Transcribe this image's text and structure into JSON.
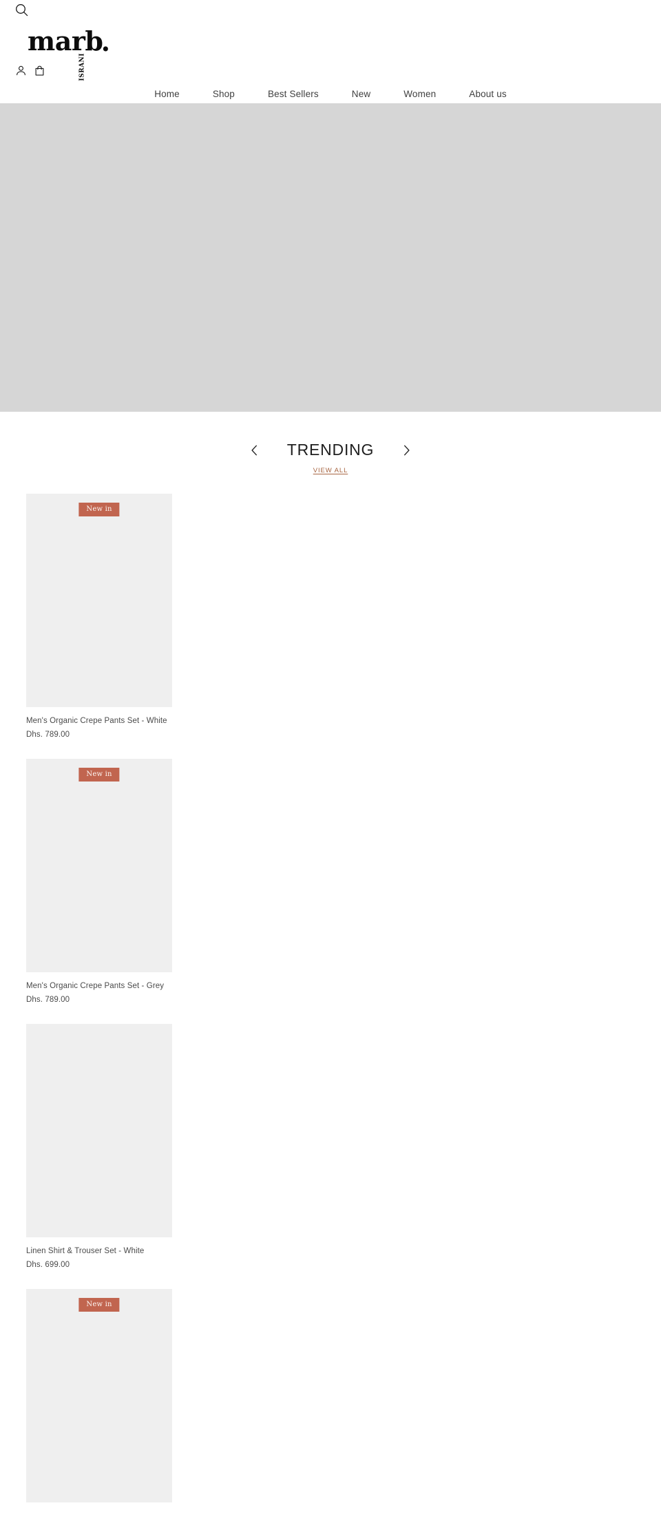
{
  "header": {
    "search_icon": "search-icon",
    "account_icon": "user-account-icon",
    "bag_icon": "shopping-bag-icon",
    "logo": {
      "wordmark": "marb",
      "vertical_text": "ISRANI",
      "dot": "."
    },
    "nav": [
      {
        "label": "Home"
      },
      {
        "label": "Shop"
      },
      {
        "label": "Best Sellers"
      },
      {
        "label": "New"
      },
      {
        "label": "Women"
      },
      {
        "label": "About us"
      }
    ]
  },
  "hero": {
    "background_color": "#d6d6d6"
  },
  "trending": {
    "title": "TRENDING",
    "prev_icon": "chevron-left-icon",
    "next_icon": "chevron-right-icon",
    "view_all_label": "VIEW ALL",
    "view_all_color": "#a6633f"
  },
  "products": [
    {
      "badge": "New in",
      "title": "Men's Organic Crepe Pants Set - White",
      "price": "Dhs. 789.00"
    },
    {
      "badge": "New in",
      "title": "Men's Organic Crepe Pants Set - Grey",
      "price": "Dhs. 789.00"
    },
    {
      "badge": "",
      "title": "Linen Shirt & Trouser Set - White",
      "price": "Dhs. 699.00"
    },
    {
      "badge": "New in",
      "title": "",
      "price": ""
    }
  ],
  "colors": {
    "badge_bg": "#c1654f",
    "card_bg": "#efefef",
    "hero_bg": "#d6d6d6",
    "text": "#4a4a4a"
  }
}
